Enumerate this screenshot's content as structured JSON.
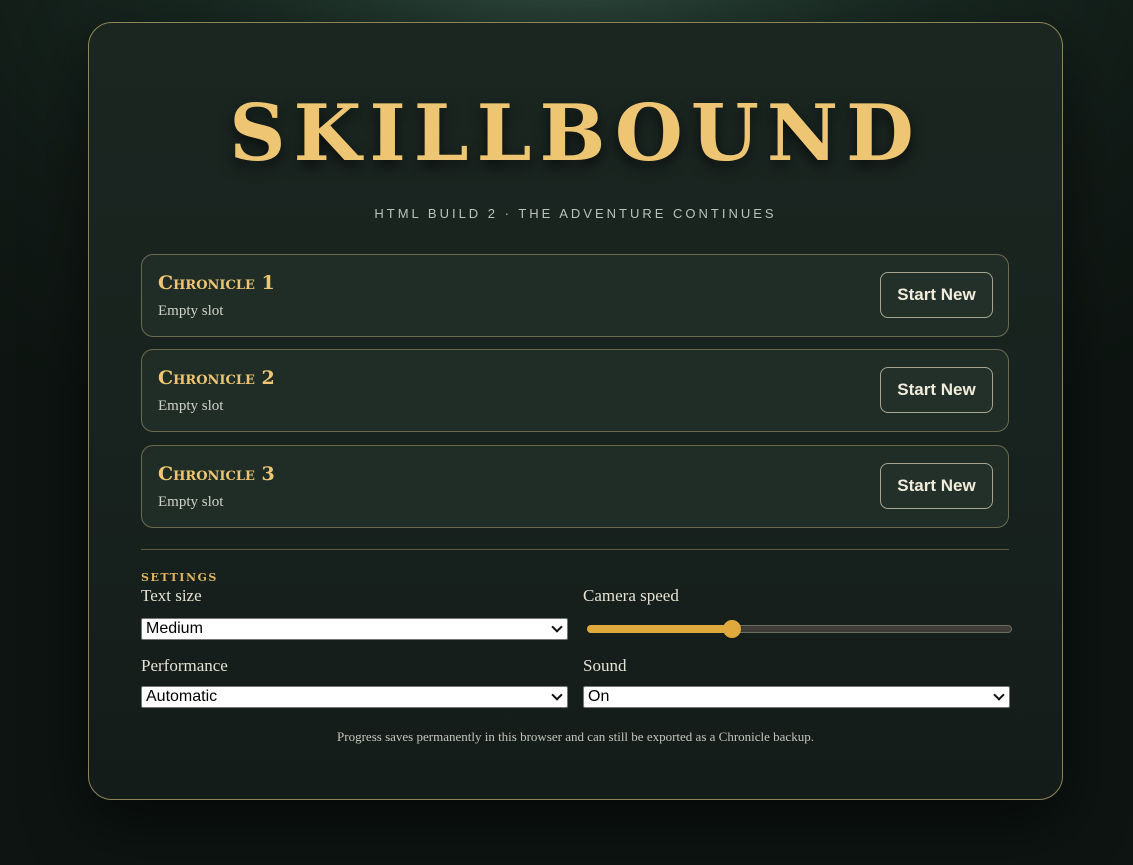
{
  "title": "SKILLBOUND",
  "subtitle": "HTML BUILD 2 · THE ADVENTURE CONTINUES",
  "slots": [
    {
      "name": "Chronicle 1",
      "status": "Empty slot",
      "action": "Start New"
    },
    {
      "name": "Chronicle 2",
      "status": "Empty slot",
      "action": "Start New"
    },
    {
      "name": "Chronicle 3",
      "status": "Empty slot",
      "action": "Start New"
    }
  ],
  "settings": {
    "heading": "SETTINGS",
    "text_size": {
      "label": "Text size",
      "value": "Medium"
    },
    "camera_speed": {
      "label": "Camera speed",
      "value": 0.34
    },
    "performance": {
      "label": "Performance",
      "value": "Automatic"
    },
    "sound": {
      "label": "Sound",
      "value": "On"
    }
  },
  "footnote": "Progress saves permanently in this browser and can still be exported as a Chronicle backup.",
  "colors": {
    "accent_gold": "#eec673",
    "slider_fill": "#e0a93b",
    "panel_border": "#8e8458"
  }
}
